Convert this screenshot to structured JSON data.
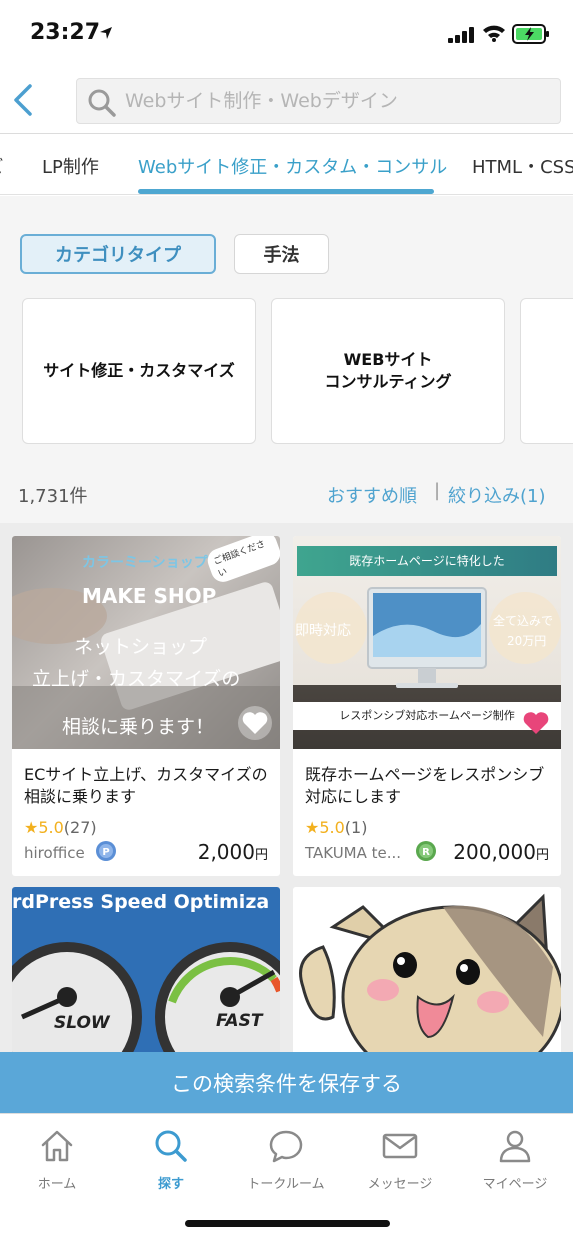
{
  "status_bar": {
    "time": "23:27"
  },
  "header": {
    "search_placeholder": "Webサイト制作・Webデザイン"
  },
  "tabs": [
    {
      "label": "ビ"
    },
    {
      "label": "LP制作"
    },
    {
      "label": "Webサイト修正・カスタム・コンサル",
      "active": true
    },
    {
      "label": "HTML・CSS"
    }
  ],
  "filters": {
    "category_type": "カテゴリタイプ",
    "method": "手法",
    "cards": [
      {
        "label": "サイト修正・カスタマイズ"
      },
      {
        "line1": "WEBサイト",
        "line2": "コンサルティング"
      }
    ],
    "result_count": "1,731件",
    "sort_label": "おすすめ順",
    "separator": "|",
    "filter_label": "絞り込み(1)"
  },
  "results": [
    {
      "thumb": {
        "line1": "カラーミーショップ",
        "line2": "MAKE SHOP",
        "line3": "ネットショップ",
        "line4": "立上げ・カスタマイズの",
        "line5": "相談に乗ります！",
        "bubble": "ご相談ください"
      },
      "title": "ECサイト立上げ、カスタマイズの相談に乗ります",
      "rating_star": "★",
      "rating_score": "5.0",
      "rating_count": "(27)",
      "seller": "hiroffice",
      "badge_letter": "P",
      "price": "2,000",
      "price_unit": "円",
      "favorited": false
    },
    {
      "thumb": {
        "top_banner": "既存ホームページに特化した",
        "left_circle": "即時対応",
        "right_circle_1": "全て込みで",
        "right_circle_2": "20万円",
        "bottom_banner": "レスポンシブ対応ホームページ制作"
      },
      "title": "既存ホームページをレスポンシブ対応にします",
      "rating_star": "★",
      "rating_score": "5.0",
      "rating_count": "(1)",
      "seller": "TAKUMA te...",
      "badge_letter": "R",
      "price": "200,000",
      "price_unit": "円",
      "favorited": true
    },
    {
      "thumb": {
        "banner": "rdPress Speed Optimiza",
        "slow": "SLOW",
        "fast": "FAST"
      }
    },
    {
      "thumb": {
        "description": "cat"
      }
    }
  ],
  "save_search": "この検索条件を保存する",
  "bottom_nav": [
    {
      "label": "ホーム",
      "icon": "home-icon"
    },
    {
      "label": "探す",
      "icon": "search-icon",
      "active": true
    },
    {
      "label": "トークルーム",
      "icon": "chat-icon"
    },
    {
      "label": "メッセージ",
      "icon": "mail-icon"
    },
    {
      "label": "マイページ",
      "icon": "person-icon"
    }
  ],
  "colors": {
    "accent": "#4ea7d1",
    "save_bar": "#5aa7d8",
    "star": "#f2b01e",
    "fav_active": "#e8457a"
  }
}
